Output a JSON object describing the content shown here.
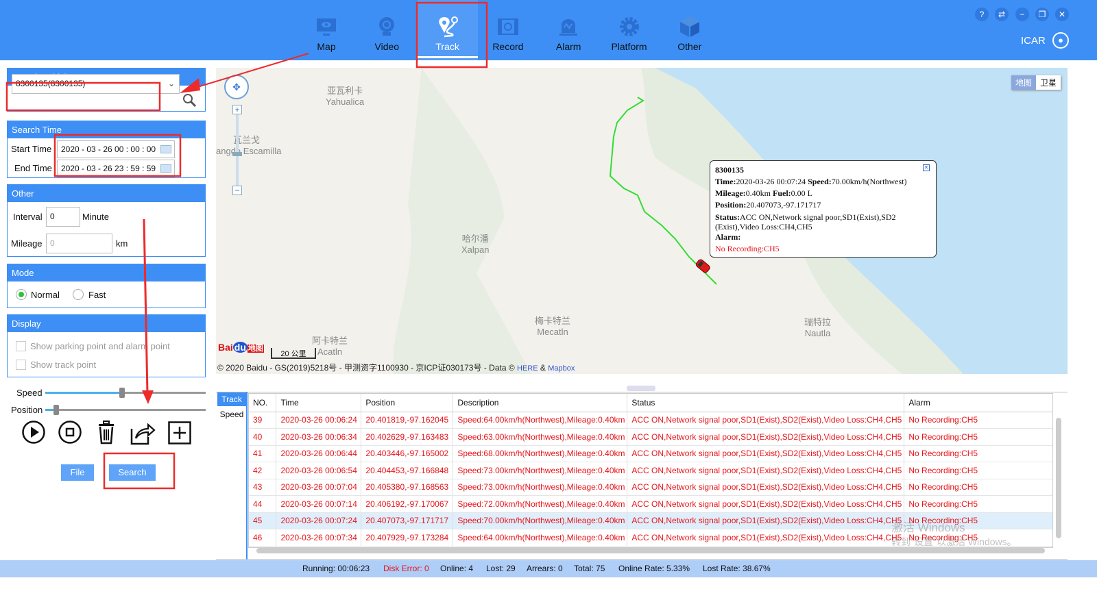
{
  "header": {
    "nav": [
      {
        "label": "Map",
        "icon": "monitor-eye-icon"
      },
      {
        "label": "Video",
        "icon": "webcam-icon"
      },
      {
        "label": "Track",
        "icon": "track-pin-icon",
        "active": true
      },
      {
        "label": "Record",
        "icon": "film-replay-icon"
      },
      {
        "label": "Alarm",
        "icon": "siren-icon"
      },
      {
        "label": "Platform",
        "icon": "gear-icon"
      },
      {
        "label": "Other",
        "icon": "cube-icon"
      }
    ],
    "window_buttons": [
      "help-icon",
      "switch-icon",
      "minimize-icon",
      "restore-icon",
      "close-icon"
    ],
    "user": "ICAR"
  },
  "colors": {
    "header": "#3d8ff5",
    "accent": "#3d8ff5",
    "alarm_text": "#e8141a",
    "track_line": "#33dd33",
    "annotation": "#ee2a2a"
  },
  "search_vehicles": {
    "title": "Search Vehicles",
    "value": "8300135(8300135)"
  },
  "search_time": {
    "title": "Search Time",
    "start_label": "Start Time",
    "start_value": "2020 - 03 - 26  00 : 00 : 00",
    "end_label": "End Time",
    "end_value": "2020 - 03 - 26  23 : 59 : 59"
  },
  "other": {
    "title": "Other",
    "interval_label": "Interval",
    "interval_value": "0",
    "interval_unit": "Minute",
    "mileage_label": "Mileage",
    "mileage_placeholder": "0",
    "mileage_unit": "km"
  },
  "mode": {
    "title": "Mode",
    "normal": "Normal",
    "fast": "Fast",
    "selected": "Normal"
  },
  "display": {
    "title": "Display",
    "opt1": "Show parking point and alarm point",
    "opt2": "Show track point"
  },
  "playback": {
    "speed_label": "Speed",
    "speed_percent": 48,
    "position_label": "Position",
    "position_percent": 7
  },
  "buttons": {
    "file": "File",
    "search": "Search"
  },
  "map": {
    "type_map": "地图",
    "type_sat": "卫星",
    "labels": [
      "亚瓦利卡",
      "Yahualica",
      "瓦兰戈",
      "angde Escamilla",
      "哈尔潘",
      "Xalpan",
      "梅卡特兰",
      "Mecatln",
      "阿卡特兰",
      "Acatln",
      "瑞特拉",
      "Nautla"
    ],
    "scale": "20 公里",
    "logo": "Bai地图",
    "copyright": "© 2020 Baidu - GS(2019)5218号 - 甲测资字1100930 - 京ICP证030173号 - Data © ",
    "here": "HERE",
    "amp": " & ",
    "mapbox": "Mapbox"
  },
  "popup": {
    "vehicle": "8300135",
    "time_label": "Time:",
    "time": "2020-03-26 00:07:24 ",
    "speed_label": "Speed:",
    "speed": "70.00km/h(Northwest)",
    "mileage_label": "Mileage:",
    "mileage": "0.40km ",
    "fuel_label": "Fuel:",
    "fuel": "0.00 L",
    "position_label": "Position:",
    "position": "20.407073,-97.171717",
    "status_label": "Status:",
    "status": "ACC ON,Network signal poor,SD1(Exist),SD2 (Exist),Video Loss:CH4,CH5",
    "alarm_label": "Alarm:",
    "alarm": "No Recording:CH5"
  },
  "bottom_tabs": [
    "Track",
    "Speed"
  ],
  "table": {
    "columns": [
      "NO.",
      "Time",
      "Position",
      "Description",
      "Status",
      "Alarm"
    ],
    "rows": [
      [
        "39",
        "2020-03-26 00:06:24",
        "20.401819,-97.162045",
        "Speed:64.00km/h(Northwest),Mileage:0.40km",
        "ACC ON,Network signal poor,SD1(Exist),SD2(Exist),Video Loss:CH4,CH5",
        "No Recording:CH5"
      ],
      [
        "40",
        "2020-03-26 00:06:34",
        "20.402629,-97.163483",
        "Speed:63.00km/h(Northwest),Mileage:0.40km",
        "ACC ON,Network signal poor,SD1(Exist),SD2(Exist),Video Loss:CH4,CH5",
        "No Recording:CH5"
      ],
      [
        "41",
        "2020-03-26 00:06:44",
        "20.403446,-97.165002",
        "Speed:68.00km/h(Northwest),Mileage:0.40km",
        "ACC ON,Network signal poor,SD1(Exist),SD2(Exist),Video Loss:CH4,CH5",
        "No Recording:CH5"
      ],
      [
        "42",
        "2020-03-26 00:06:54",
        "20.404453,-97.166848",
        "Speed:73.00km/h(Northwest),Mileage:0.40km",
        "ACC ON,Network signal poor,SD1(Exist),SD2(Exist),Video Loss:CH4,CH5",
        "No Recording:CH5"
      ],
      [
        "43",
        "2020-03-26 00:07:04",
        "20.405380,-97.168563",
        "Speed:73.00km/h(Northwest),Mileage:0.40km",
        "ACC ON,Network signal poor,SD1(Exist),SD2(Exist),Video Loss:CH4,CH5",
        "No Recording:CH5"
      ],
      [
        "44",
        "2020-03-26 00:07:14",
        "20.406192,-97.170067",
        "Speed:72.00km/h(Northwest),Mileage:0.40km",
        "ACC ON,Network signal poor,SD1(Exist),SD2(Exist),Video Loss:CH4,CH5",
        "No Recording:CH5"
      ],
      [
        "45",
        "2020-03-26 00:07:24",
        "20.407073,-97.171717",
        "Speed:70.00km/h(Northwest),Mileage:0.40km",
        "ACC ON,Network signal poor,SD1(Exist),SD2(Exist),Video Loss:CH4,CH5",
        "No Recording:CH5"
      ],
      [
        "46",
        "2020-03-26 00:07:34",
        "20.407929,-97.173284",
        "Speed:64.00km/h(Northwest),Mileage:0.40km",
        "ACC ON,Network signal poor,SD1(Exist),SD2(Exist),Video Loss:CH4,CH5",
        "No Recording:CH5"
      ]
    ],
    "selected_row": "45"
  },
  "watermark": {
    "line1": "激活 Windows",
    "line2": "转到\"设置\"以激活 Windows。"
  },
  "status_bar": {
    "running": "Running:  00:06:23",
    "disk_error": "Disk Error:  0",
    "online": "Online:  4",
    "lost": "Lost:  29",
    "arrears": "Arrears:  0",
    "total": "Total:  75",
    "online_rate": "Online Rate:  5.33%",
    "lost_rate": "Lost Rate:  38.67%"
  }
}
